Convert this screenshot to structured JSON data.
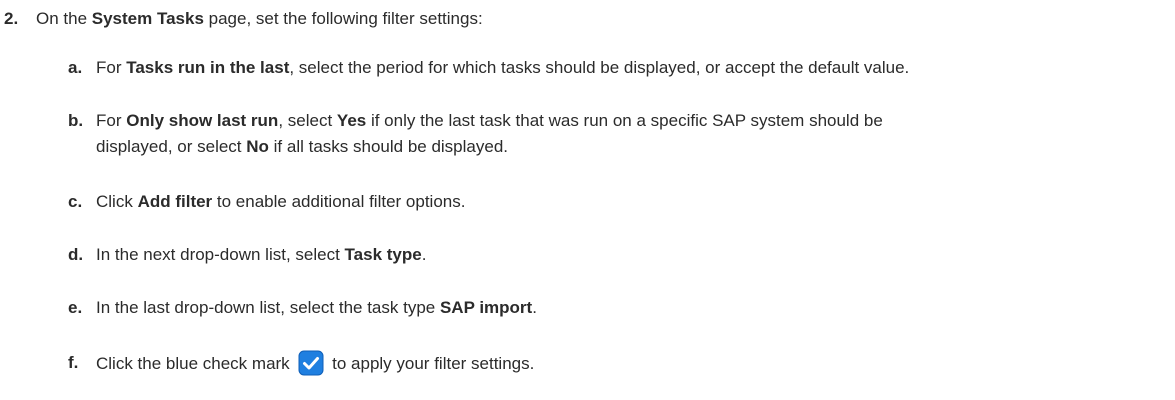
{
  "step": {
    "number": "2.",
    "text_1": "On the ",
    "page_name": "System Tasks",
    "text_2": " page, set the following filter settings:"
  },
  "substeps": {
    "a": {
      "letter": "a.",
      "t1": "For ",
      "b1": "Tasks run in the last",
      "t2": ", select the period for which tasks should be displayed, or accept the default value."
    },
    "b": {
      "letter": "b.",
      "t1": "For ",
      "b1": "Only show last run",
      "t2": ", select ",
      "b2": "Yes",
      "t3": " if only the last task that was run on a specific SAP system should be",
      "t4": "displayed, or select ",
      "b3": "No",
      "t5": " if all tasks should be displayed."
    },
    "c": {
      "letter": "c.",
      "t1": "Click ",
      "b1": "Add filter",
      "t2": " to enable additional filter options."
    },
    "d": {
      "letter": "d.",
      "t1": "In the next drop-down list, select ",
      "b1": "Task type",
      "t2": "."
    },
    "e": {
      "letter": "e.",
      "t1": "In the last drop-down list, select the task type ",
      "b1": "SAP import",
      "t2": "."
    },
    "f": {
      "letter": "f.",
      "t1": "Click the blue check mark ",
      "icon": "check-mark-icon",
      "t2": " to apply your filter settings."
    }
  },
  "colors": {
    "text": "#2b2b2b",
    "check_blue": "#1f7fe0"
  }
}
